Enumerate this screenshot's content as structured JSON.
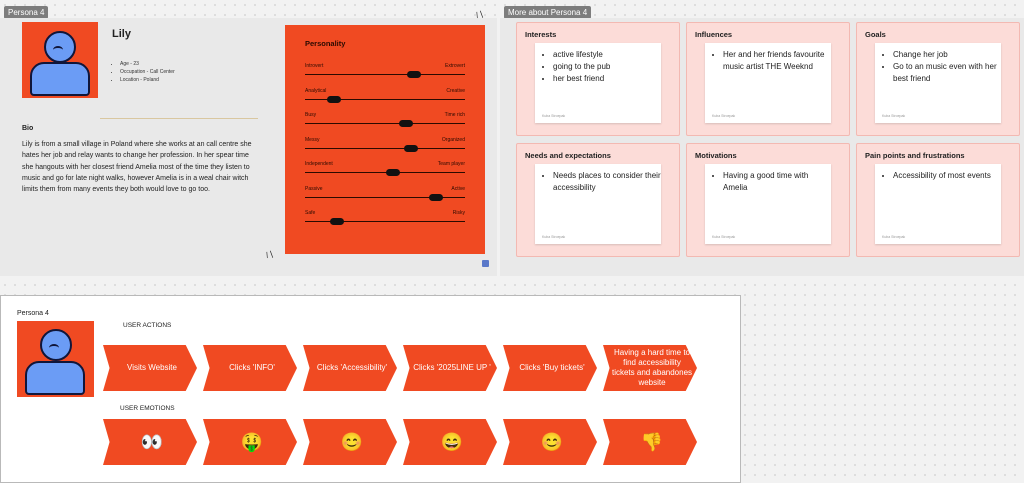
{
  "persona_frame": {
    "label": "Persona 4",
    "name": "Lily",
    "details": [
      "Age - 23",
      "Occupation - Call Center",
      "Location - Poland"
    ],
    "bio_title": "Bio",
    "bio": "Lily is from a small village in Poland where she works at an call centre she hates her job and relay wants to change her profession. In her spear time she hangouts with her closest friend Amelia most of the time they listen to music and go for late night walks, however Amelia is in a weal chair witch limits them from many events they both would love to go too.",
    "personality": {
      "title": "Personality",
      "traits": [
        {
          "left": "Introvert",
          "right": "Extrovert",
          "value": 0.68
        },
        {
          "left": "Analytical",
          "right": "Creative",
          "value": 0.18
        },
        {
          "left": "Busy",
          "right": "Time rich",
          "value": 0.63
        },
        {
          "left": "Messy",
          "right": "Organized",
          "value": 0.66
        },
        {
          "left": "Independent",
          "right": "Team player",
          "value": 0.55
        },
        {
          "left": "Passive",
          "right": "Active",
          "value": 0.82
        },
        {
          "left": "Safe",
          "right": "Risky",
          "value": 0.2
        }
      ]
    }
  },
  "more_frame": {
    "label": "More about Persona 4",
    "cards": [
      {
        "title": "Interests",
        "items": [
          "active lifestyle",
          "going to the pub",
          "her best friend"
        ],
        "author": "Kuba Stroepak"
      },
      {
        "title": "Influences",
        "items": [
          "Her and her friends favourite music artist THE Weeknd"
        ],
        "author": "Kuba Stroepak"
      },
      {
        "title": "Goals",
        "items": [
          "Change her job",
          "Go to an music even with her best friend"
        ],
        "author": "Kuba Stroepak"
      },
      {
        "title": "Needs and expectations",
        "items": [
          "Needs places to consider their accessibility"
        ],
        "author": "Kuba Stroepak"
      },
      {
        "title": "Motivations",
        "items": [
          "Having a good time with Amelia"
        ],
        "author": "Kuba Stroepak"
      },
      {
        "title": "Pain points and frustrations",
        "items": [
          "Accessibility of most events"
        ],
        "author": "Kuba Stroepak"
      }
    ]
  },
  "journey": {
    "label": "Persona 4",
    "actions_label": "USER ACTIONS",
    "emotions_label": "USER EMOTIONS",
    "actions": [
      "Visits Website",
      "Clicks 'INFO'",
      "Clicks 'Accessibility'",
      "Clicks '2025LINE UP '",
      "Clicks 'Buy tickets'",
      "Having a hard time  to find accessibility tickets and abandones website"
    ],
    "emotions": [
      "👀",
      "🤑",
      "😊",
      "😄",
      "😊",
      "👎"
    ]
  },
  "colors": {
    "accent": "#f04a22",
    "avatar": "#6b9cf5",
    "card": "#fcdcd8"
  },
  "icons": {
    "user_badge": "user-icon"
  }
}
